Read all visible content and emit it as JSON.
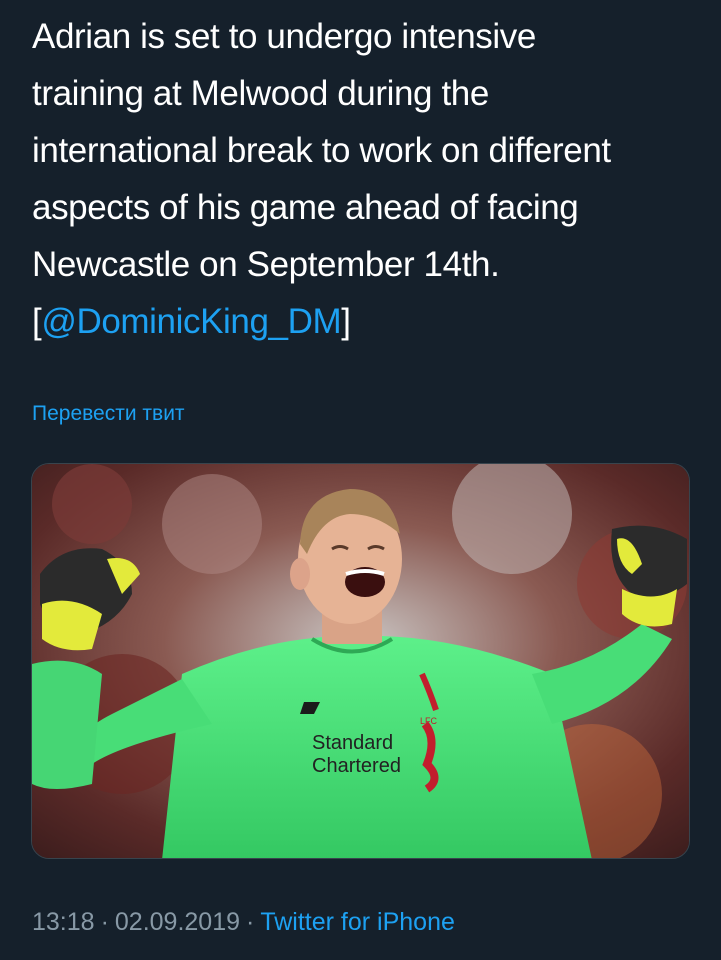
{
  "tweet": {
    "text_lines": [
      "Adrian is set to undergo intensive",
      "training at Melwood during the",
      "international break to work on different",
      "aspects of his game ahead of facing",
      "Newcastle on September 14th."
    ],
    "mention_open": "[",
    "mention": "@DominicKing_DM",
    "mention_close": "]",
    "translate_label": "Перевести твит",
    "time": "13:18",
    "date": "02.09.2019",
    "source": "Twitter for iPhone",
    "separator": "·"
  },
  "media": {
    "kit_sponsor_line1": "Standard",
    "kit_sponsor_line2": "Chartered",
    "kit_club": "LFC"
  },
  "colors": {
    "background": "#15202b",
    "link": "#1da1f2",
    "meta": "#8899a6",
    "jersey": "#4ee37a"
  }
}
